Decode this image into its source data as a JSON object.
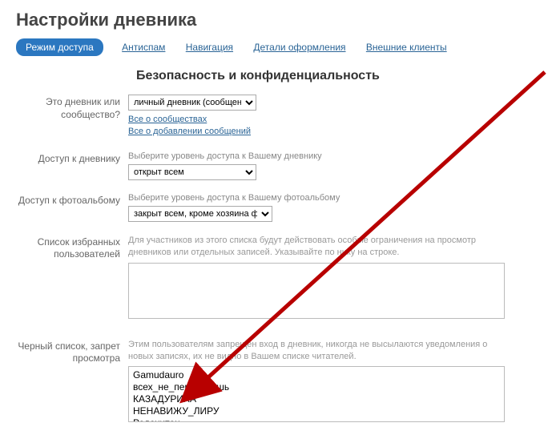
{
  "page_title": "Настройки дневника",
  "tabs": {
    "active": "Режим доступа",
    "items": [
      "Режим доступа",
      "Антиспам",
      "Навигация",
      "Детали оформления",
      "Внешние клиенты"
    ]
  },
  "section_heading": "Безопасность и конфиденциальность",
  "fields": {
    "type": {
      "label": "Это дневник или сообщество?",
      "value": "личный дневник (сообщения д",
      "links": [
        "Все о сообществах",
        "Все о добавлении сообщений"
      ]
    },
    "diary_access": {
      "label": "Доступ к дневнику",
      "help": "Выберите уровень доступа к Вашему дневнику",
      "value": "открыт всем"
    },
    "photo_access": {
      "label": "Доступ к фотоальбому",
      "help": "Выберите уровень доступа к Вашему фотоальбому",
      "value": "закрыт всем, кроме хозяина фо"
    },
    "favorites": {
      "label": "Список избранных пользователей",
      "desc": "Для участников из этого списка будут действовать особые ограничения на просмотр дневников или отдельных записей. Указывайте по нику на строке.",
      "value": ""
    },
    "blacklist": {
      "label": "Черный список, запрет просмотра",
      "desc": "Этим пользователям запрещен вход в дневник, никогда не высылаются уведомления о новых записях, их не видно в Вашем списке читателей.",
      "value": "Gamudauro\nвсех_не_перебанишь\nКАЗАДУРИХА\nНЕНАВИЖУ_ЛИРУ\nРодохитон"
    }
  },
  "arrow_color": "#b80000"
}
